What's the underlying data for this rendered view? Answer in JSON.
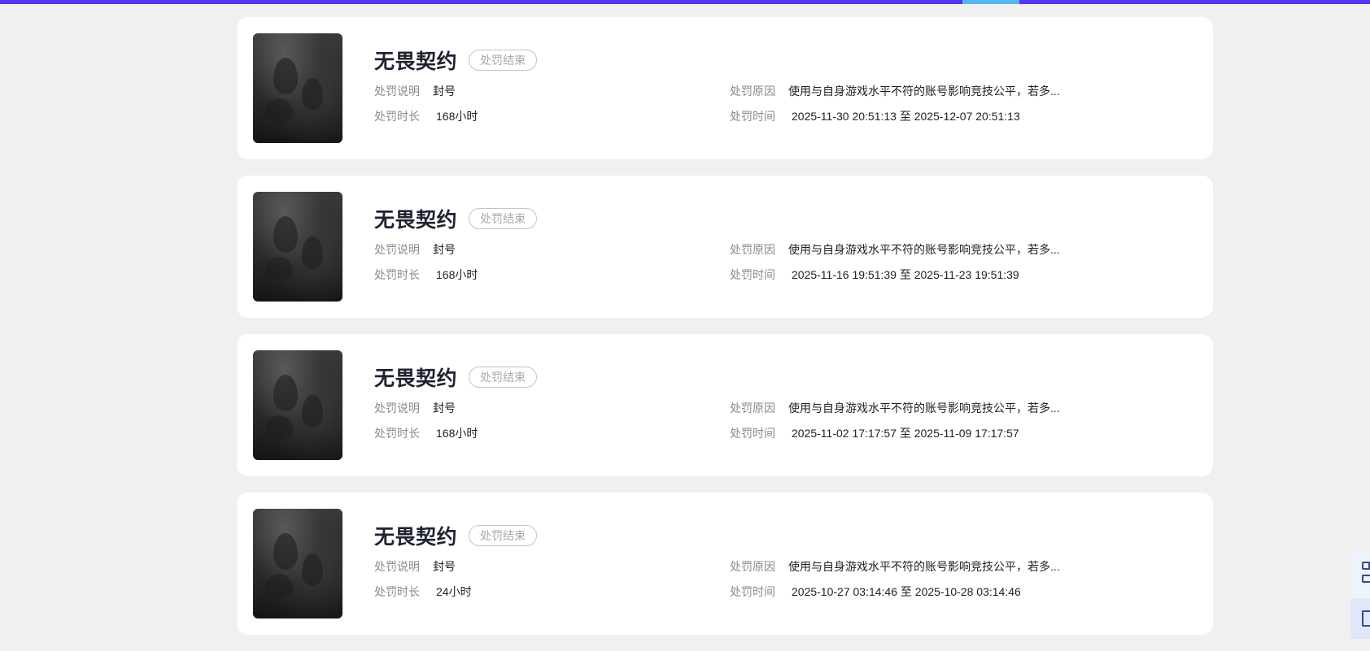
{
  "penalties": [
    {
      "game": "无畏契约",
      "status": "处罚结束",
      "desc_label": "处罚说明",
      "desc_value": "封号",
      "duration_label": "处罚时长",
      "duration_value": "168小时",
      "reason_label": "处罚原因",
      "reason_value": "使用与自身游戏水平不符的账号影响竞技公平，若多...",
      "time_label": "处罚时间",
      "time_value": "2025-11-30 20:51:13 至 2025-12-07 20:51:13"
    },
    {
      "game": "无畏契约",
      "status": "处罚结束",
      "desc_label": "处罚说明",
      "desc_value": "封号",
      "duration_label": "处罚时长",
      "duration_value": "168小时",
      "reason_label": "处罚原因",
      "reason_value": "使用与自身游戏水平不符的账号影响竞技公平，若多...",
      "time_label": "处罚时间",
      "time_value": "2025-11-16 19:51:39 至 2025-11-23 19:51:39"
    },
    {
      "game": "无畏契约",
      "status": "处罚结束",
      "desc_label": "处罚说明",
      "desc_value": "封号",
      "duration_label": "处罚时长",
      "duration_value": "168小时",
      "reason_label": "处罚原因",
      "reason_value": "使用与自身游戏水平不符的账号影响竞技公平，若多...",
      "time_label": "处罚时间",
      "time_value": "2025-11-02 17:17:57 至 2025-11-09 17:17:57"
    },
    {
      "game": "无畏契约",
      "status": "处罚结束",
      "desc_label": "处罚说明",
      "desc_value": "封号",
      "duration_label": "处罚时长",
      "duration_value": "24小时",
      "reason_label": "处罚原因",
      "reason_value": "使用与自身游戏水平不符的账号影响竞技公平，若多...",
      "time_label": "处罚时间",
      "time_value": "2025-10-27 03:14:46 至 2025-10-28 03:14:46"
    }
  ],
  "colors": {
    "top_bar": "#4f35f5",
    "top_bar_indicator": "#4fb8f5",
    "page_background": "#f0f0f0",
    "card_background": "#ffffff"
  },
  "icons": {
    "side_widget_top": "qr-code-icon",
    "side_widget_bottom": "panel-icon"
  }
}
